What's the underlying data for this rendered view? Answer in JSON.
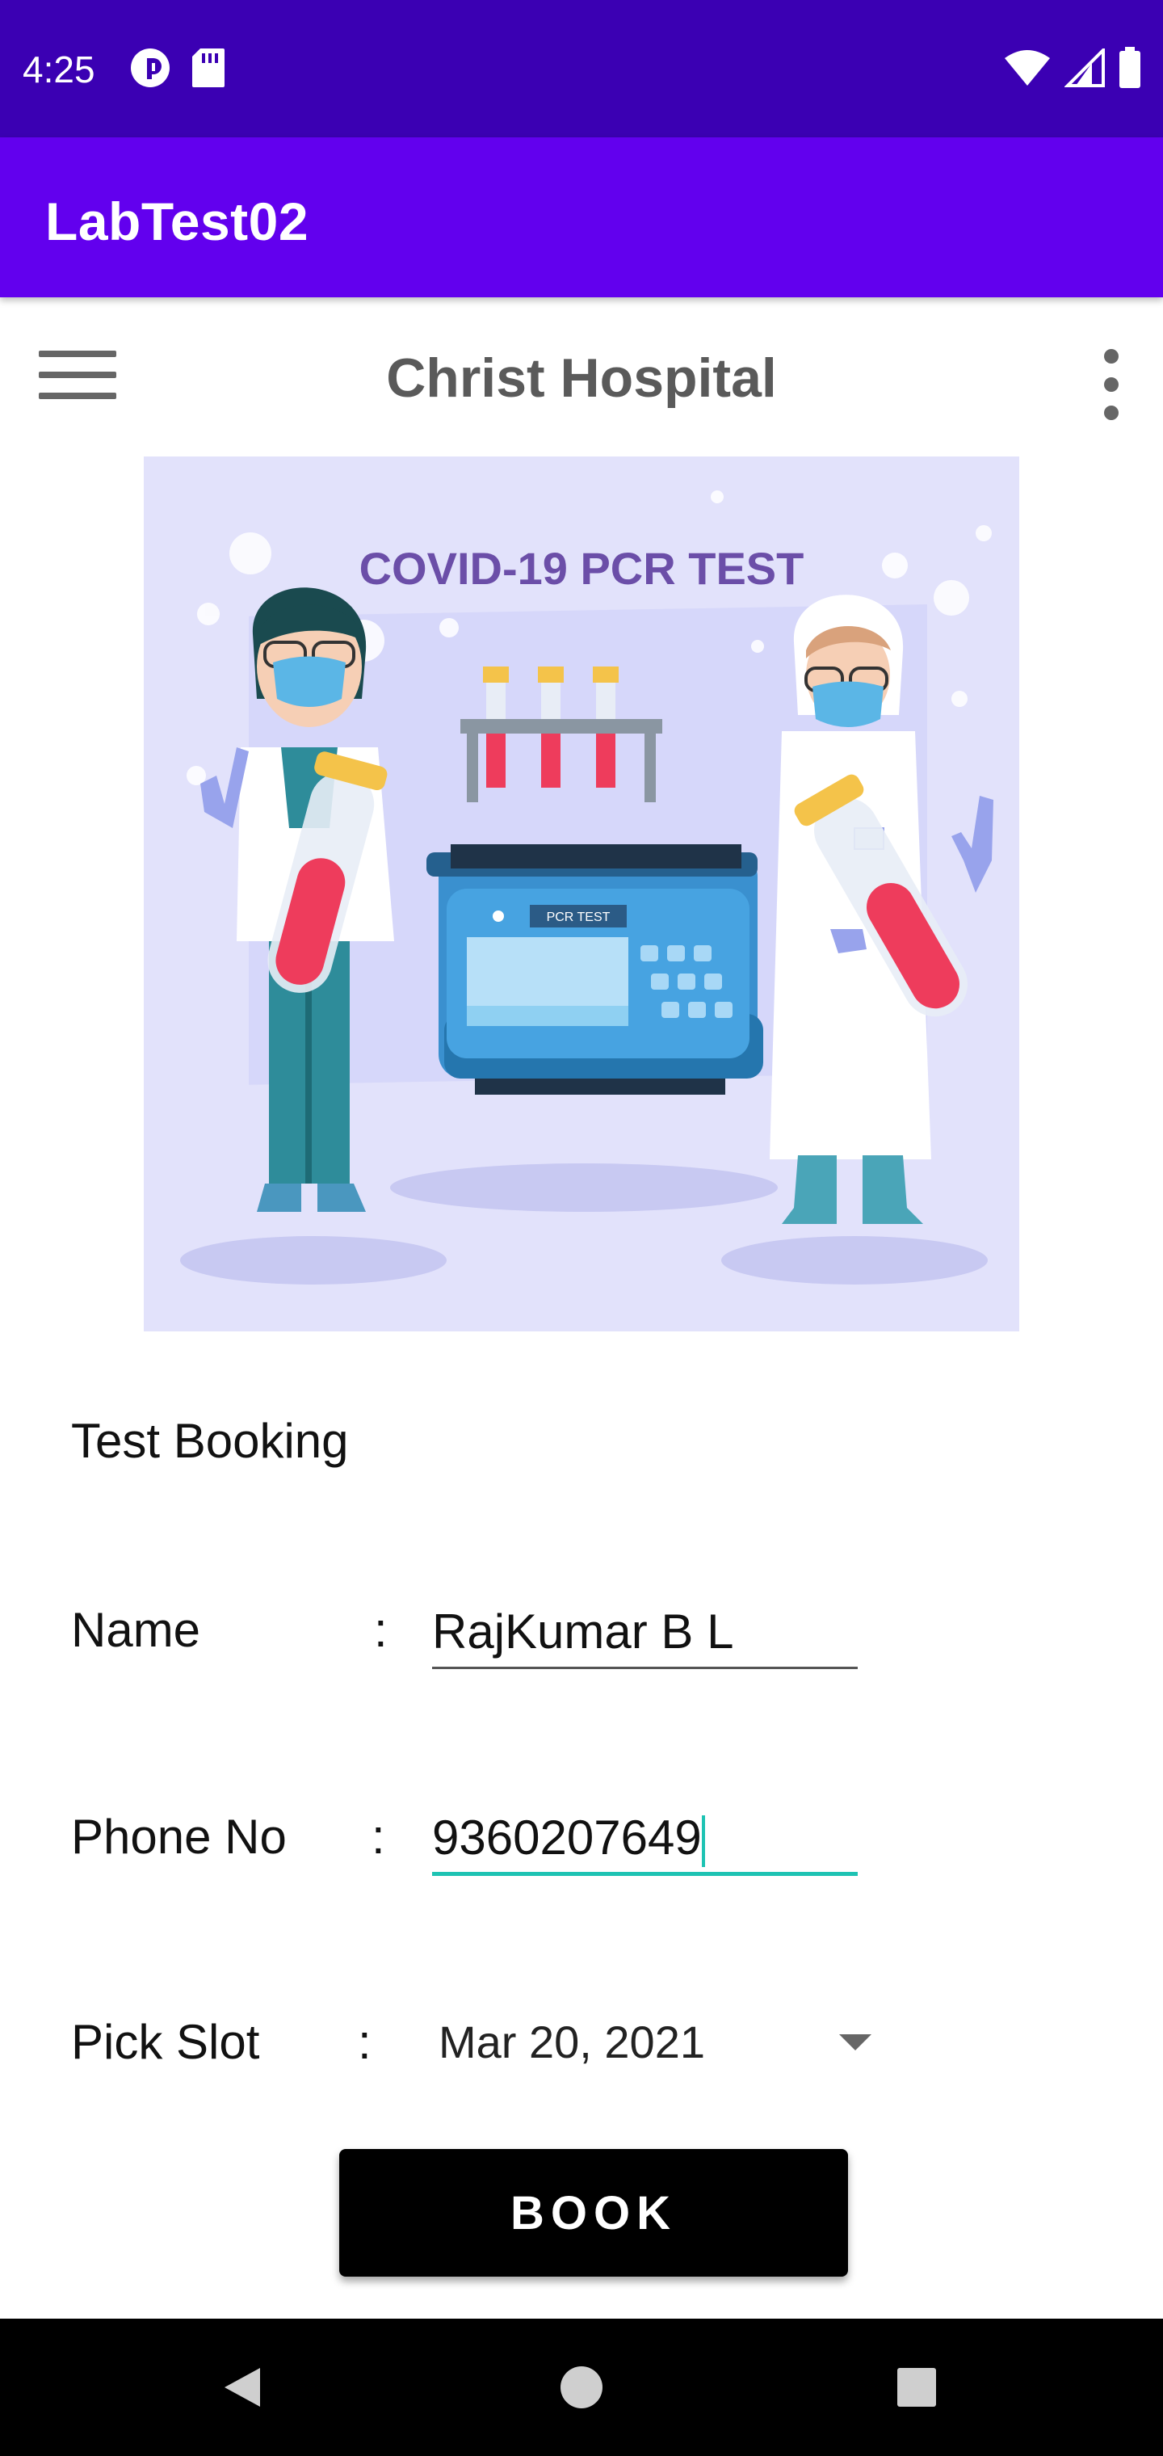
{
  "status_bar": {
    "time": "4:25",
    "left_icons": [
      "data-saver-icon",
      "sd-card-icon"
    ],
    "right_icons": [
      "wifi-icon",
      "cellular-signal-icon",
      "battery-icon"
    ],
    "background": "#3b00b3"
  },
  "app_bar": {
    "title": "LabTest02",
    "background": "#6200ee"
  },
  "toolbar": {
    "title": "Christ Hospital",
    "menu_icon": "hamburger-menu-icon",
    "overflow_icon": "more-vert-icon"
  },
  "hero_image": {
    "caption": "COVID-19 PCR TEST",
    "machine_label": "PCR TEST",
    "background": "#e2e2fb"
  },
  "form": {
    "heading": "Test Booking",
    "name": {
      "label": "Name",
      "colon": ":",
      "value": "RajKumar B L"
    },
    "phone": {
      "label": "Phone No",
      "colon": ":",
      "value": "9360207649"
    },
    "slot": {
      "label": "Pick Slot",
      "colon": ":",
      "value": "Mar 20, 2021"
    },
    "accent": "#1ec3b3"
  },
  "book_button": {
    "label": "BOOK"
  },
  "nav_bar": {
    "buttons": [
      "back-icon",
      "home-icon",
      "recents-icon"
    ]
  }
}
